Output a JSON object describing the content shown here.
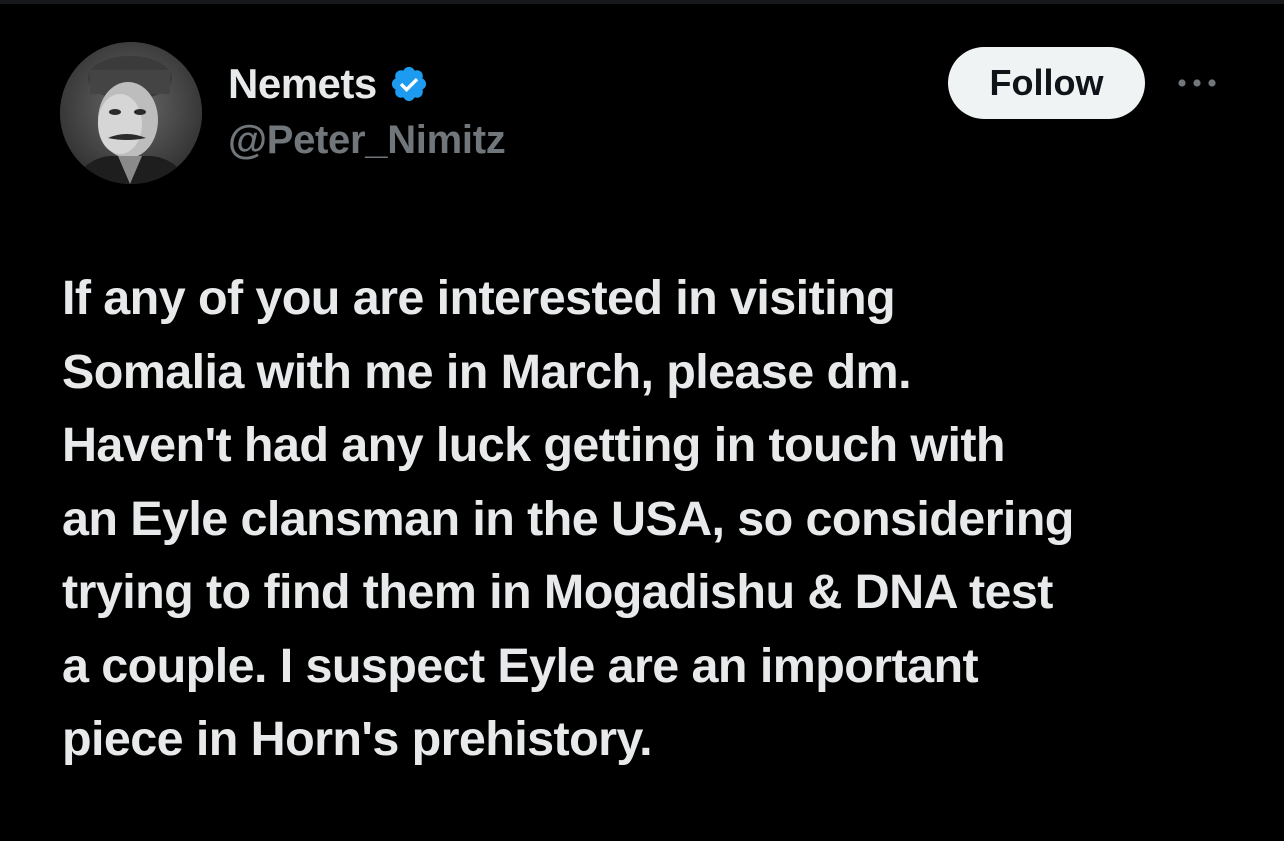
{
  "author": {
    "display_name": "Nemets",
    "handle": "@Peter_Nimitz",
    "verified": true,
    "verified_color": "#1d9bf0",
    "avatar": "avatar-photo"
  },
  "actions": {
    "follow_label": "Follow",
    "more_icon": "ellipsis-icon"
  },
  "tweet": {
    "lines": [
      "If any of you are interested in visiting",
      "Somalia with me in March, please dm.",
      "Haven't had any luck getting in touch with",
      "an Eyle clansman in the USA, so considering",
      "trying to find them in Mogadishu & DNA test",
      "a couple. I suspect Eyle are an important",
      "piece in Horn's prehistory."
    ]
  },
  "colors": {
    "background": "#000000",
    "text_primary": "#e7e9ea",
    "text_secondary": "#71767b",
    "button_bg": "#eff3f4",
    "button_text": "#0f1419"
  }
}
